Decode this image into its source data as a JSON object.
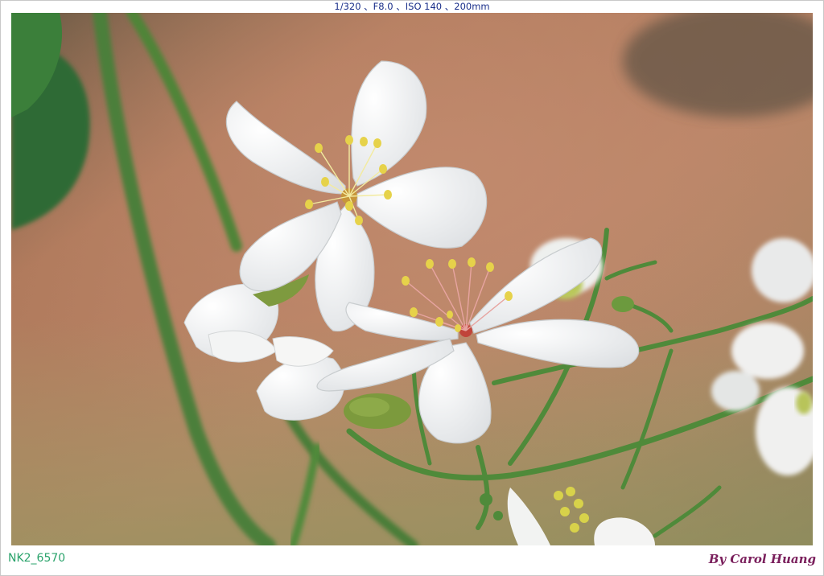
{
  "header": {
    "exif": "1/320 、F8.0 、ISO 140 、200mm"
  },
  "footer": {
    "file_id": "NK2_6570",
    "signature": "By Carol Huang"
  },
  "photo": {
    "subject": "white-flower-cluster",
    "colors": {
      "background_warm": "#b07a5c",
      "background_dark": "#5a4a3a",
      "stem_green": "#4f8a3a",
      "petal_white": "#f7f7f5",
      "stamen_yellow": "#e6d24a",
      "center_red": "#c0443a"
    }
  }
}
